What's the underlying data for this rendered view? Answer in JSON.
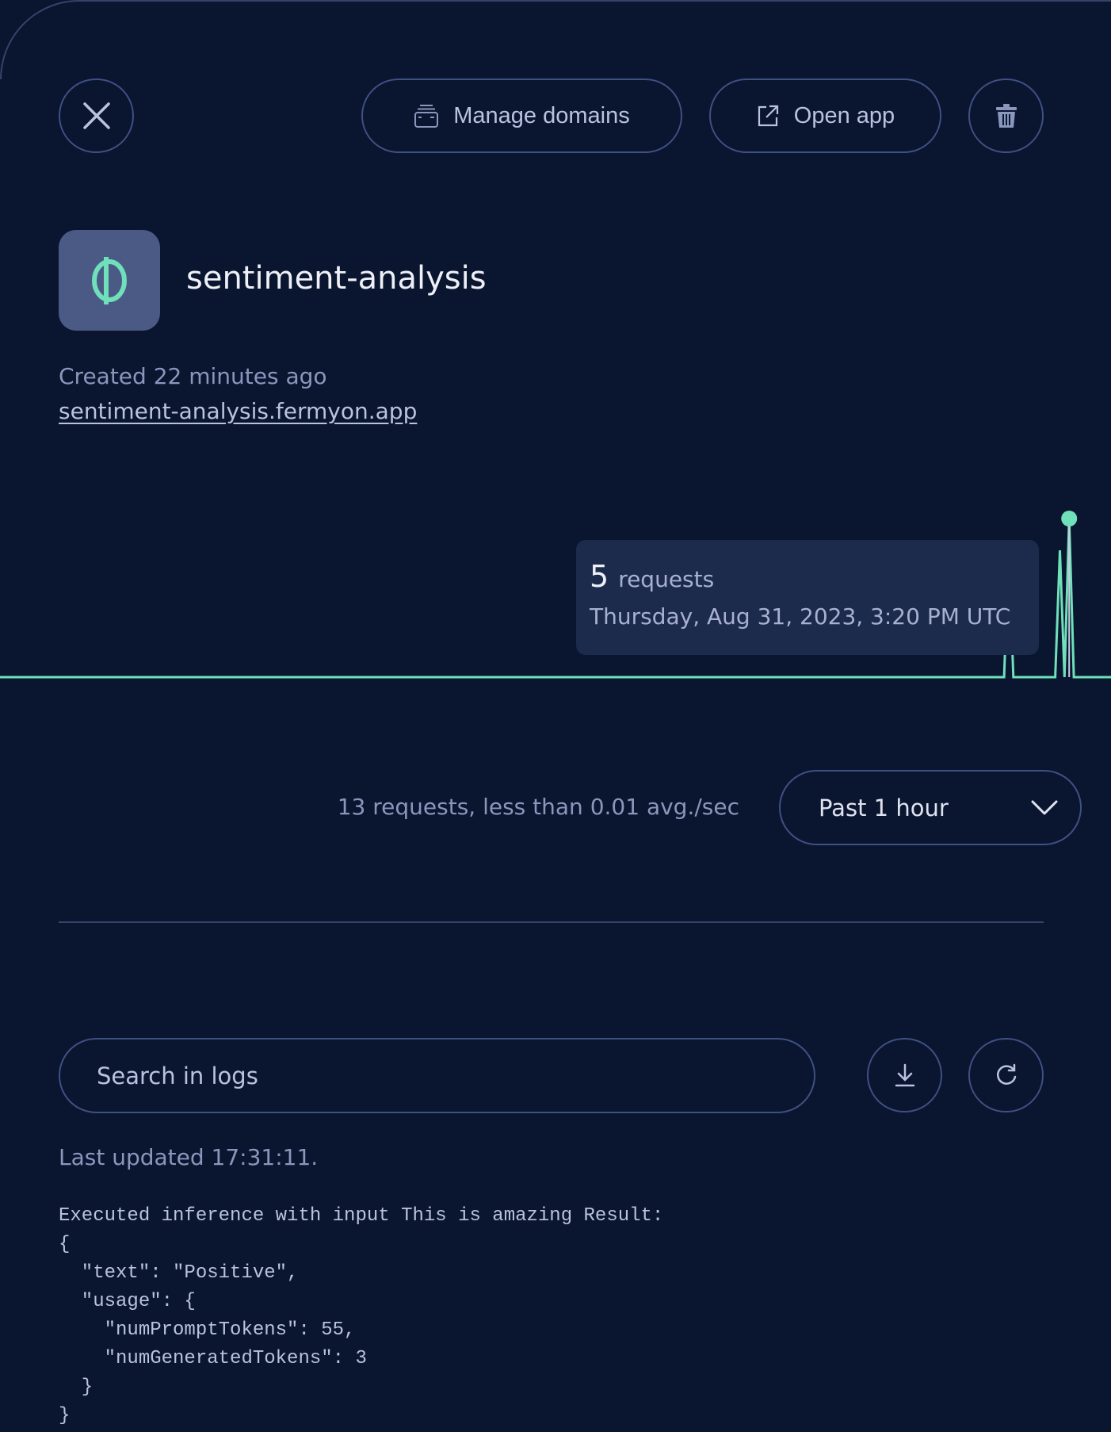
{
  "header": {
    "close_icon": "close-icon",
    "manage_domains_label": "Manage domains",
    "open_app_label": "Open app",
    "delete_icon": "trash-icon"
  },
  "app": {
    "icon": "phi-logo",
    "name": "sentiment-analysis",
    "created": "Created 22 minutes ago",
    "url": "sentiment-analysis.fermyon.app"
  },
  "colors": {
    "accent": "#6fe0b9",
    "background": "#0a1530",
    "tooltip": "#1c2a4c",
    "border": "#3f5083"
  },
  "chart_data": {
    "type": "line",
    "series": [
      {
        "values_nonzero": {
          "217": 4,
          "228": 4,
          "230": 5
        },
        "bucket_count": 240
      }
    ],
    "highlighted_bucket": 230,
    "grid": false,
    "tooltip": {
      "count": "5",
      "unit": "requests",
      "date": "Thursday, Aug 31, 2023, 3:20 PM UTC"
    }
  },
  "stats": {
    "summary": "13 requests, less than 0.01 avg./sec",
    "range_selected": "Past 1 hour"
  },
  "logs": {
    "search_placeholder": "Search in logs",
    "download_icon": "download-icon",
    "refresh_icon": "refresh-icon",
    "last_updated": "Last updated 17:31:11.",
    "content": "Executed inference with input This is amazing Result:\n{\n  \"text\": \"Positive\",\n  \"usage\": {\n    \"numPromptTokens\": 55,\n    \"numGeneratedTokens\": 3\n  }\n}"
  }
}
